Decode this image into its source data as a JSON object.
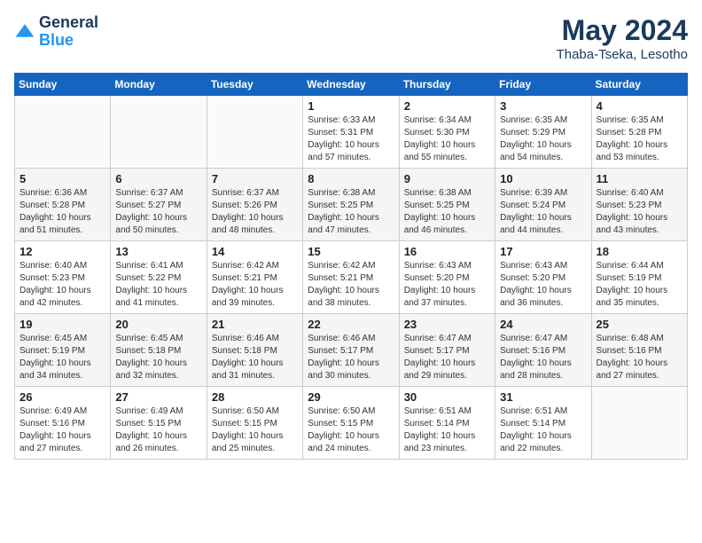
{
  "header": {
    "logo_line1": "General",
    "logo_line2": "Blue",
    "month_year": "May 2024",
    "location": "Thaba-Tseka, Lesotho"
  },
  "days_of_week": [
    "Sunday",
    "Monday",
    "Tuesday",
    "Wednesday",
    "Thursday",
    "Friday",
    "Saturday"
  ],
  "weeks": [
    [
      {
        "day": "",
        "content": ""
      },
      {
        "day": "",
        "content": ""
      },
      {
        "day": "",
        "content": ""
      },
      {
        "day": "1",
        "content": "Sunrise: 6:33 AM\nSunset: 5:31 PM\nDaylight: 10 hours\nand 57 minutes."
      },
      {
        "day": "2",
        "content": "Sunrise: 6:34 AM\nSunset: 5:30 PM\nDaylight: 10 hours\nand 55 minutes."
      },
      {
        "day": "3",
        "content": "Sunrise: 6:35 AM\nSunset: 5:29 PM\nDaylight: 10 hours\nand 54 minutes."
      },
      {
        "day": "4",
        "content": "Sunrise: 6:35 AM\nSunset: 5:28 PM\nDaylight: 10 hours\nand 53 minutes."
      }
    ],
    [
      {
        "day": "5",
        "content": "Sunrise: 6:36 AM\nSunset: 5:28 PM\nDaylight: 10 hours\nand 51 minutes."
      },
      {
        "day": "6",
        "content": "Sunrise: 6:37 AM\nSunset: 5:27 PM\nDaylight: 10 hours\nand 50 minutes."
      },
      {
        "day": "7",
        "content": "Sunrise: 6:37 AM\nSunset: 5:26 PM\nDaylight: 10 hours\nand 48 minutes."
      },
      {
        "day": "8",
        "content": "Sunrise: 6:38 AM\nSunset: 5:25 PM\nDaylight: 10 hours\nand 47 minutes."
      },
      {
        "day": "9",
        "content": "Sunrise: 6:38 AM\nSunset: 5:25 PM\nDaylight: 10 hours\nand 46 minutes."
      },
      {
        "day": "10",
        "content": "Sunrise: 6:39 AM\nSunset: 5:24 PM\nDaylight: 10 hours\nand 44 minutes."
      },
      {
        "day": "11",
        "content": "Sunrise: 6:40 AM\nSunset: 5:23 PM\nDaylight: 10 hours\nand 43 minutes."
      }
    ],
    [
      {
        "day": "12",
        "content": "Sunrise: 6:40 AM\nSunset: 5:23 PM\nDaylight: 10 hours\nand 42 minutes."
      },
      {
        "day": "13",
        "content": "Sunrise: 6:41 AM\nSunset: 5:22 PM\nDaylight: 10 hours\nand 41 minutes."
      },
      {
        "day": "14",
        "content": "Sunrise: 6:42 AM\nSunset: 5:21 PM\nDaylight: 10 hours\nand 39 minutes."
      },
      {
        "day": "15",
        "content": "Sunrise: 6:42 AM\nSunset: 5:21 PM\nDaylight: 10 hours\nand 38 minutes."
      },
      {
        "day": "16",
        "content": "Sunrise: 6:43 AM\nSunset: 5:20 PM\nDaylight: 10 hours\nand 37 minutes."
      },
      {
        "day": "17",
        "content": "Sunrise: 6:43 AM\nSunset: 5:20 PM\nDaylight: 10 hours\nand 36 minutes."
      },
      {
        "day": "18",
        "content": "Sunrise: 6:44 AM\nSunset: 5:19 PM\nDaylight: 10 hours\nand 35 minutes."
      }
    ],
    [
      {
        "day": "19",
        "content": "Sunrise: 6:45 AM\nSunset: 5:19 PM\nDaylight: 10 hours\nand 34 minutes."
      },
      {
        "day": "20",
        "content": "Sunrise: 6:45 AM\nSunset: 5:18 PM\nDaylight: 10 hours\nand 32 minutes."
      },
      {
        "day": "21",
        "content": "Sunrise: 6:46 AM\nSunset: 5:18 PM\nDaylight: 10 hours\nand 31 minutes."
      },
      {
        "day": "22",
        "content": "Sunrise: 6:46 AM\nSunset: 5:17 PM\nDaylight: 10 hours\nand 30 minutes."
      },
      {
        "day": "23",
        "content": "Sunrise: 6:47 AM\nSunset: 5:17 PM\nDaylight: 10 hours\nand 29 minutes."
      },
      {
        "day": "24",
        "content": "Sunrise: 6:47 AM\nSunset: 5:16 PM\nDaylight: 10 hours\nand 28 minutes."
      },
      {
        "day": "25",
        "content": "Sunrise: 6:48 AM\nSunset: 5:16 PM\nDaylight: 10 hours\nand 27 minutes."
      }
    ],
    [
      {
        "day": "26",
        "content": "Sunrise: 6:49 AM\nSunset: 5:16 PM\nDaylight: 10 hours\nand 27 minutes."
      },
      {
        "day": "27",
        "content": "Sunrise: 6:49 AM\nSunset: 5:15 PM\nDaylight: 10 hours\nand 26 minutes."
      },
      {
        "day": "28",
        "content": "Sunrise: 6:50 AM\nSunset: 5:15 PM\nDaylight: 10 hours\nand 25 minutes."
      },
      {
        "day": "29",
        "content": "Sunrise: 6:50 AM\nSunset: 5:15 PM\nDaylight: 10 hours\nand 24 minutes."
      },
      {
        "day": "30",
        "content": "Sunrise: 6:51 AM\nSunset: 5:14 PM\nDaylight: 10 hours\nand 23 minutes."
      },
      {
        "day": "31",
        "content": "Sunrise: 6:51 AM\nSunset: 5:14 PM\nDaylight: 10 hours\nand 22 minutes."
      },
      {
        "day": "",
        "content": ""
      }
    ]
  ]
}
